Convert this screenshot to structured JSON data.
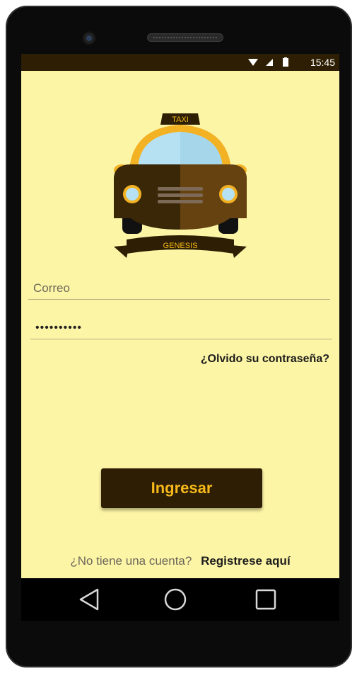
{
  "status_bar": {
    "time": "15:45"
  },
  "logo": {
    "sign_text": "TAXI",
    "banner_text": "GENESIS"
  },
  "form": {
    "email_placeholder": "Correo",
    "password_value": "••••••••••",
    "forgot_label": "¿Olvido su contraseña?",
    "submit_label": "Ingresar"
  },
  "register": {
    "question": "¿No tiene una cuenta?",
    "link_label": "Registrese aquí"
  },
  "nav": {
    "back_icon": "triangle-back-icon",
    "home_icon": "circle-home-icon",
    "recents_icon": "square-recents-icon"
  },
  "colors": {
    "screen_bg": "#fdf5a6",
    "dark_brown": "#2e1f04",
    "accent_yellow": "#f6b81a"
  }
}
